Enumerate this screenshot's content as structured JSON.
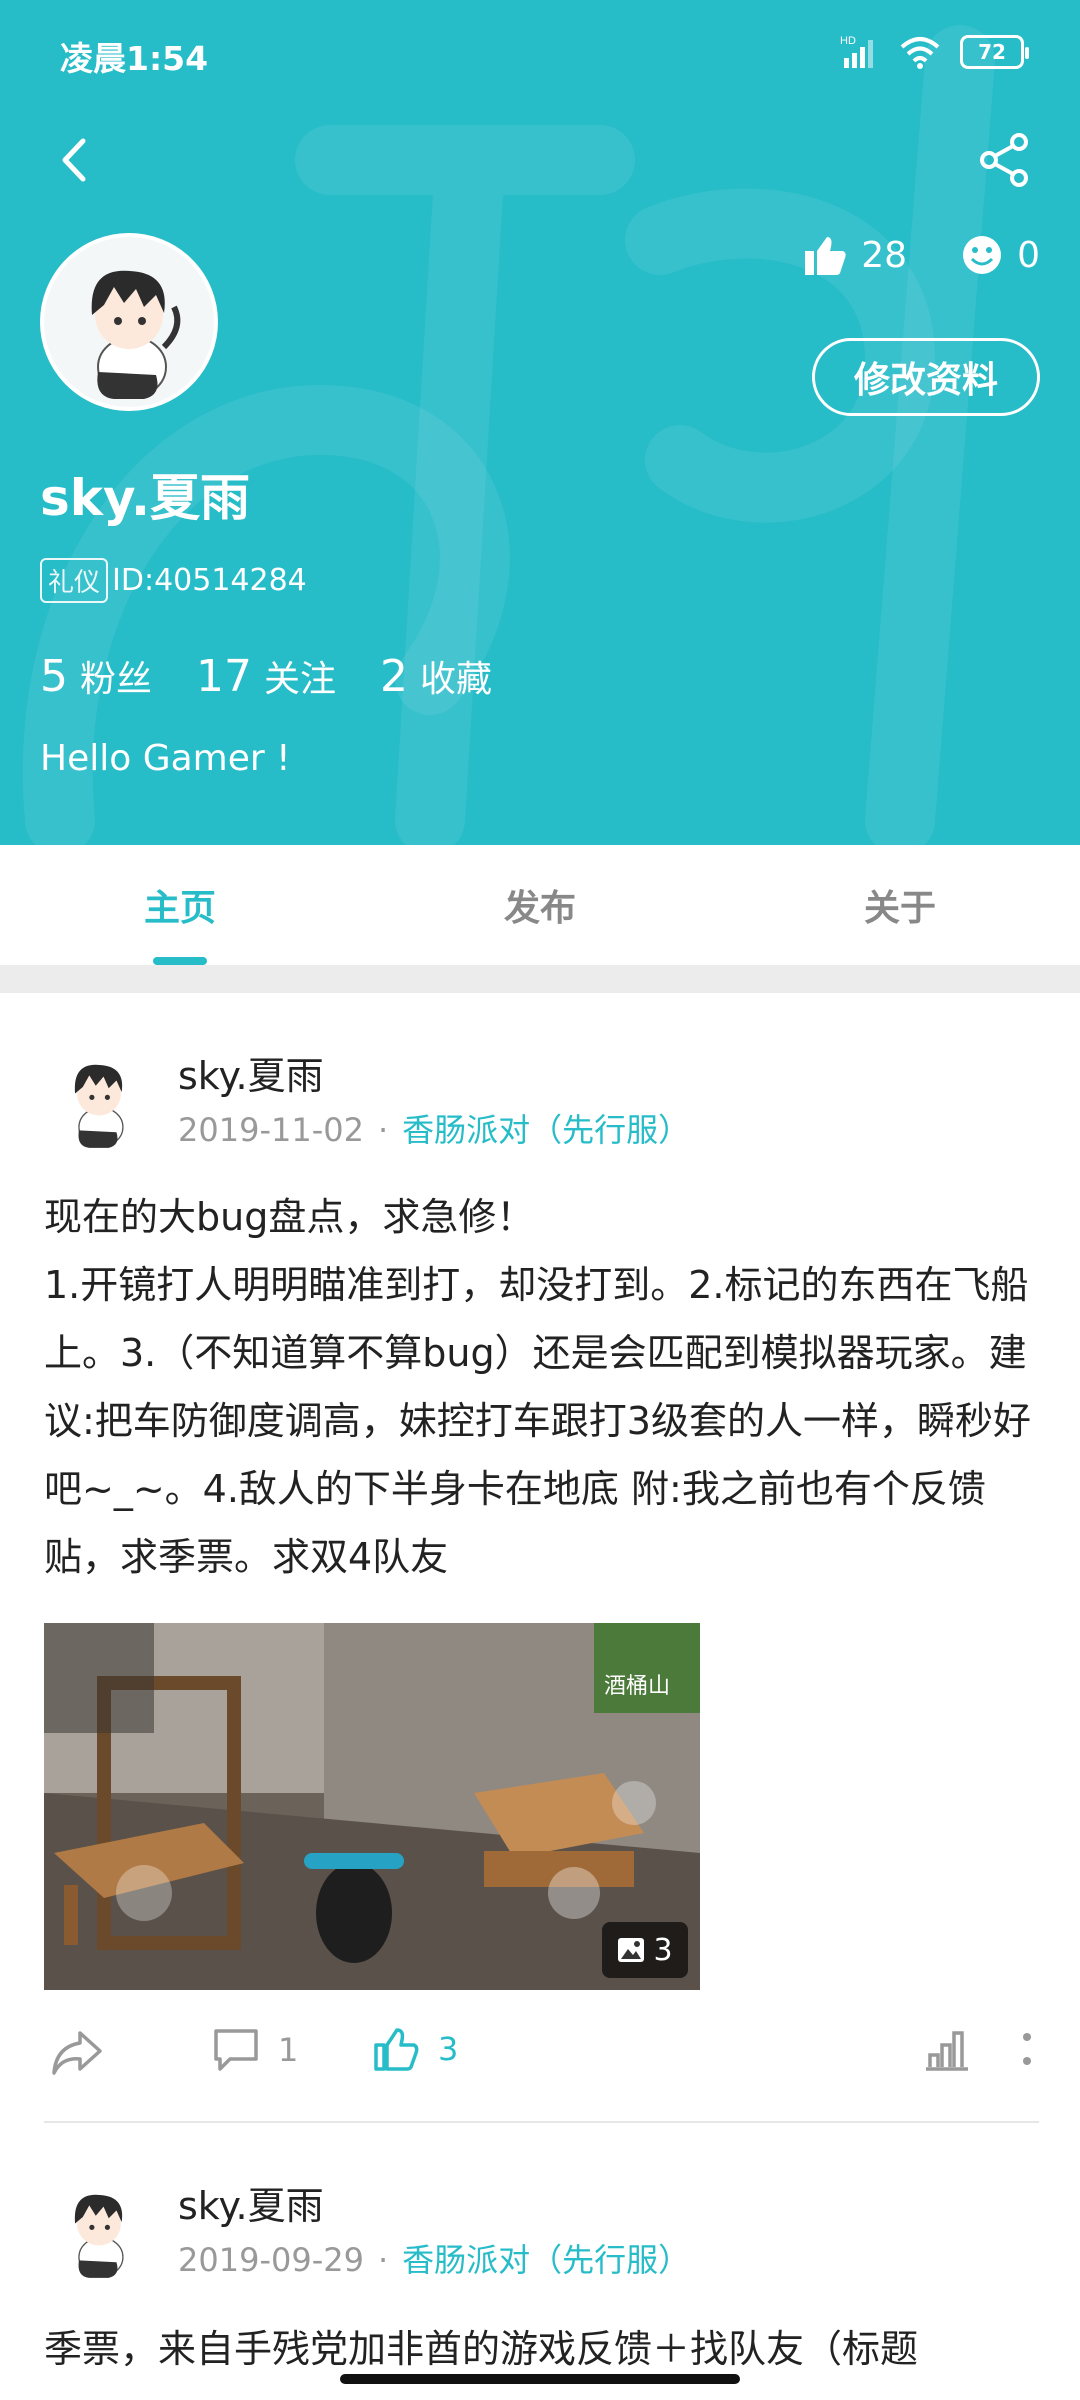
{
  "status_bar": {
    "time": "凌晨1:54",
    "battery": "72",
    "network": "HD"
  },
  "profile": {
    "username": "sky.夏雨",
    "tag": "礼仪",
    "id_text": "ID:40514284",
    "likes": "28",
    "smiles": "0",
    "edit_label": "修改资料",
    "followers_num": "5",
    "followers_label": "粉丝",
    "following_num": "17",
    "following_label": "关注",
    "favorites_num": "2",
    "favorites_label": "收藏",
    "bio": "Hello Gamer !"
  },
  "tabs": [
    {
      "label": "主页",
      "active": true
    },
    {
      "label": "发布",
      "active": false
    },
    {
      "label": "关于",
      "active": false
    }
  ],
  "posts": [
    {
      "user": "sky.夏雨",
      "date": "2019-11-02",
      "separator": "·",
      "game": "香肠派对（先行服）",
      "body": "现在的大bug盘点，求急修！\n1.开镜打人明明瞄准到打，却没打到。2.标记的东西在飞船上。3.（不知道算不算bug）还是会匹配到模拟器玩家。建议:把车防御度调高，妹控打车跟打3级套的人一样，瞬秒好吧~_~。4.敌人的下半身卡在地底 附:我之前也有个反馈贴，求季票。求双4队友",
      "image_count": "3",
      "image_caption": "酒桶山",
      "comments": "1",
      "likes": "3"
    },
    {
      "user": "sky.夏雨",
      "date": "2019-09-29",
      "separator": "·",
      "game": "香肠派对（先行服）",
      "body": "季票，来自手残党加非酋的游戏反馈＋找队友（标题"
    }
  ],
  "colors": {
    "accent": "#26bcc8",
    "text": "#222222",
    "muted": "#999999"
  }
}
